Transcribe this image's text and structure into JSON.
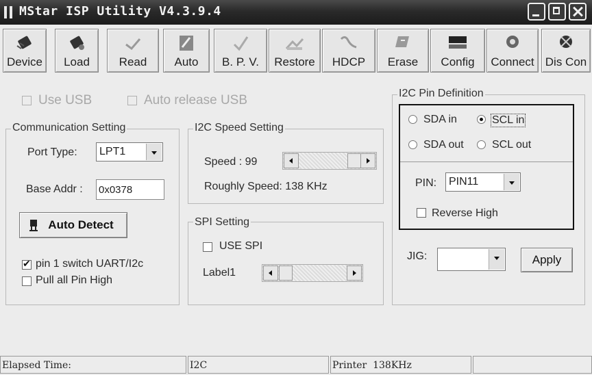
{
  "window": {
    "title": "MStar ISP Utility V4.3.9.4"
  },
  "toolbar": [
    {
      "label": "Device",
      "icon": "device-chip-icon"
    },
    {
      "label": "Load",
      "icon": "load-chip-icon"
    },
    {
      "label": "Read",
      "icon": "read-icon"
    },
    {
      "label": "Auto",
      "icon": "auto-icon"
    },
    {
      "label": "B. P. V.",
      "icon": "bpv-check-icon"
    },
    {
      "label": "Restore",
      "icon": "restore-icon"
    },
    {
      "label": "HDCP",
      "icon": "hdcp-icon"
    },
    {
      "label": "Erase",
      "icon": "erase-icon"
    },
    {
      "label": "Config",
      "icon": "config-icon"
    },
    {
      "label": "Connect",
      "icon": "connect-icon"
    },
    {
      "label": "Dis Con",
      "icon": "disconnect-icon"
    }
  ],
  "usb": {
    "use_usb": "Use USB",
    "auto_release_usb": "Auto release USB"
  },
  "communication": {
    "title": "Communication Setting",
    "port_type_label": "Port Type:",
    "port_type_value": "LPT1",
    "base_addr_label": "Base Addr :",
    "base_addr_value": "0x0378",
    "auto_detect_label": "Auto Detect",
    "pin1_switch_label": "pin 1 switch UART/I2c",
    "pin1_switch_checked": true,
    "pull_all_label": "Pull all Pin High",
    "pull_all_checked": false
  },
  "i2c_speed": {
    "title": "I2C Speed Setting",
    "speed_label": "Speed : 99",
    "roughly_label": "Roughly Speed: 138 KHz",
    "slider_value": 99
  },
  "spi": {
    "title": "SPI Setting",
    "use_spi_label": "USE SPI",
    "label1": "Label1"
  },
  "i2c_pin": {
    "title": "I2C Pin Definition",
    "sda_in": "SDA in",
    "scl_in": "SCL in",
    "sda_out": "SDA out",
    "scl_out": "SCL out",
    "selected": "SCL in",
    "pin_label": "PIN:",
    "pin_value": "PIN11",
    "reverse_high": "Reverse High"
  },
  "jig": {
    "label": "JIG:",
    "value": "",
    "apply": "Apply"
  },
  "status": {
    "elapsed": "Elapsed Time:",
    "bus": "I2C",
    "printer": "Printer  138KHz"
  }
}
